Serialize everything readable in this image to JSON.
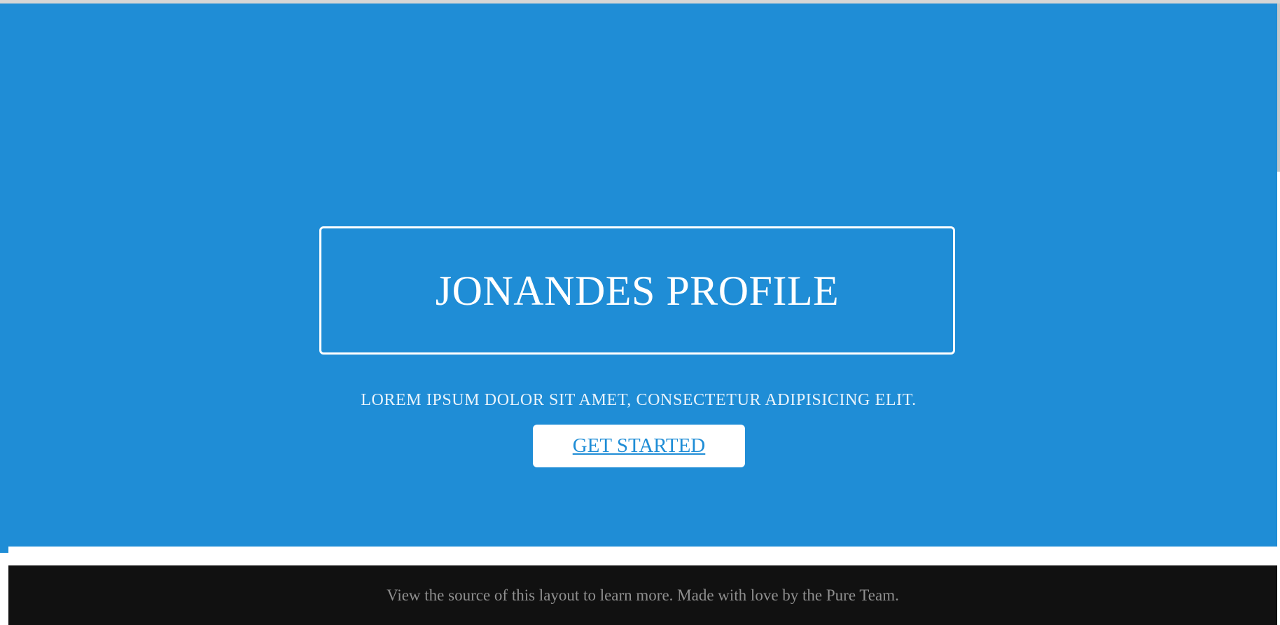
{
  "hero": {
    "title": "JONANDES PROFILE",
    "subtitle": "LOREM IPSUM DOLOR SIT AMET, CONSECTETUR ADIPISICING ELIT.",
    "cta_label": "GET STARTED"
  },
  "footer": {
    "text": "View the source of this layout to learn more. Made with love by the Pure Team."
  },
  "colors": {
    "hero_background": "#1f8dd6",
    "footer_background": "#111111",
    "footer_text": "#8f8f8f",
    "cta_text": "#1f8dd6"
  }
}
